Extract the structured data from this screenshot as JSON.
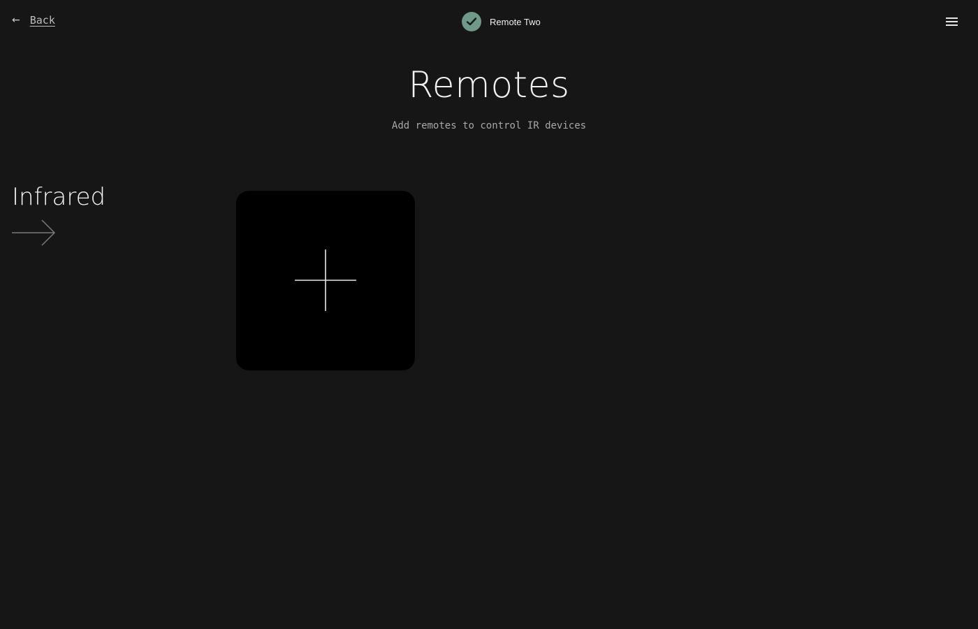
{
  "header": {
    "back_label": "Back",
    "back_icon": "arrow-left-icon",
    "device_name": "Remote Two",
    "status_icon": "check-circle-icon",
    "menu_icon": "hamburger-menu-icon"
  },
  "page": {
    "title": "Remotes",
    "subtitle": "Add remotes to control IR devices"
  },
  "section": {
    "title": "Infrared",
    "arrow_icon": "arrow-right-icon",
    "add_tile_icon": "plus-icon"
  },
  "colors": {
    "background": "#161616",
    "tile": "#000000",
    "status_badge": "#6f9a8a"
  }
}
